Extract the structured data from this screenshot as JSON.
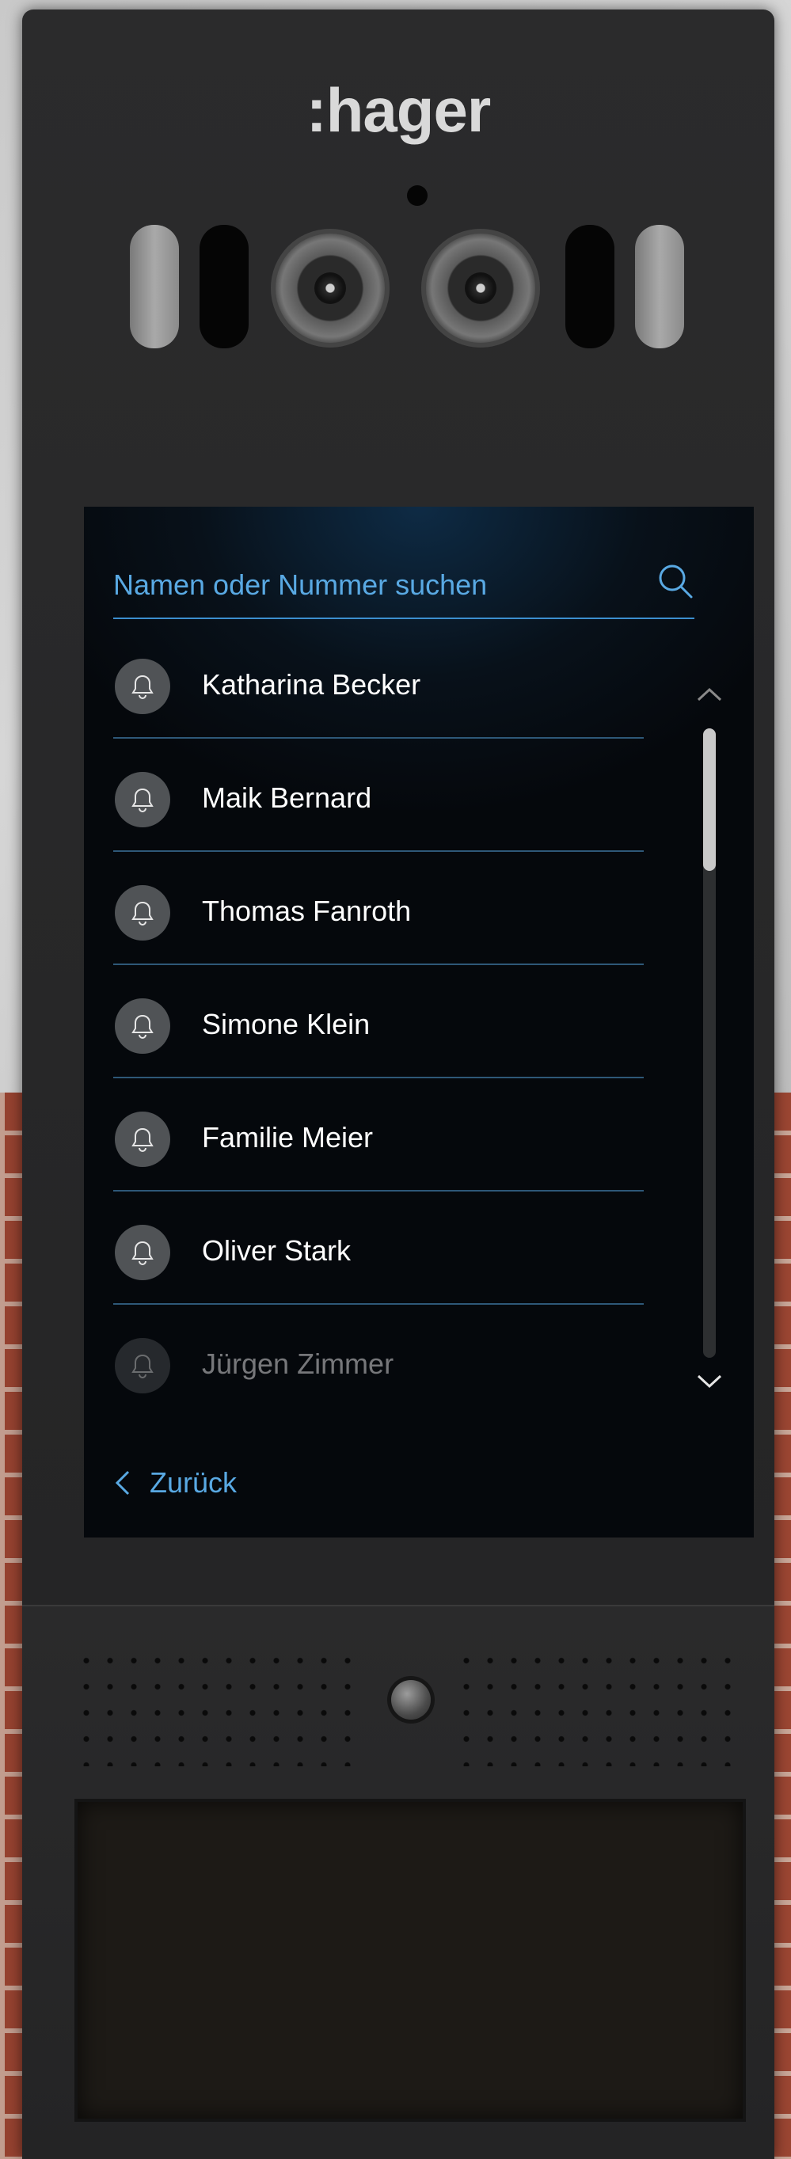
{
  "brand": {
    "logo_text": ":hager"
  },
  "search": {
    "placeholder": "Namen oder Nummer suchen",
    "icon": "search-icon"
  },
  "contacts": [
    {
      "name": "Katharina Becker"
    },
    {
      "name": "Maik Bernard"
    },
    {
      "name": "Thomas Fanroth"
    },
    {
      "name": "Simone Klein"
    },
    {
      "name": "Familie Meier"
    },
    {
      "name": "Oliver Stark"
    },
    {
      "name": "Jürgen Zimmer"
    }
  ],
  "navigation": {
    "back_label": "Zurück"
  },
  "colors": {
    "accent": "#59a9e3",
    "divider": "#2e5878",
    "text": "#ffffff",
    "bell_background": "#505356"
  }
}
